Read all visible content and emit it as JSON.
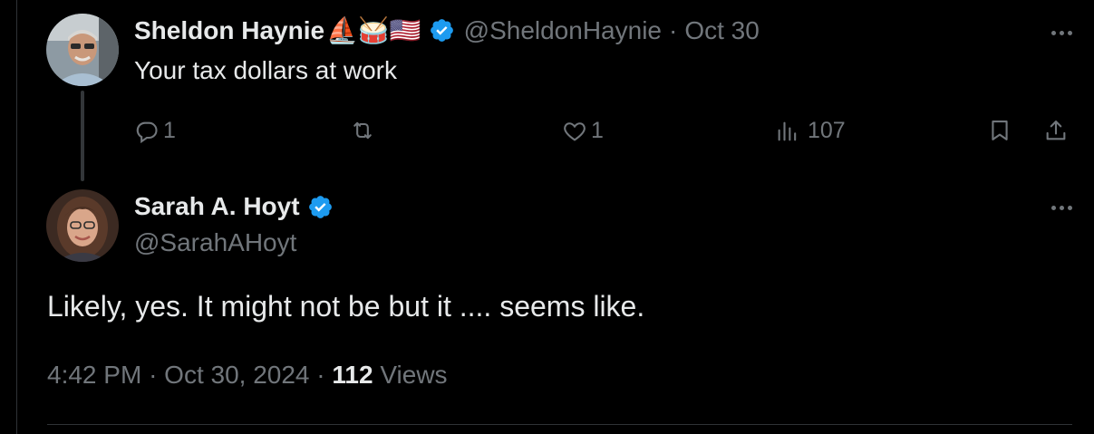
{
  "reply_to": {
    "display_name": "Sheldon Haynie",
    "name_emojis": "⛵🥁🇺🇸",
    "handle": "@SheldonHaynie",
    "separator": "·",
    "date": "Oct 30",
    "text": "Your tax dollars at work",
    "actions": {
      "reply_count": "1",
      "retweet_count": "",
      "like_count": "1",
      "views_count": "107"
    },
    "icons": [
      "reply-icon",
      "retweet-icon",
      "heart-icon",
      "views-icon",
      "bookmark-icon",
      "share-icon",
      "more-icon",
      "verified-badge-icon"
    ]
  },
  "main_tweet": {
    "display_name": "Sarah A. Hoyt",
    "handle": "@SarahAHoyt",
    "text": "Likely, yes. It might not be but it .... seems like.",
    "time": "4:42 PM",
    "separator": "·",
    "date": "Oct 30, 2024",
    "views_count": "112",
    "views_label": "Views"
  },
  "colors": {
    "background": "#000000",
    "primary_text": "#e7e9ea",
    "secondary_text": "#71767b",
    "verified_blue": "#1d9bf0",
    "divider": "#2f3336"
  }
}
